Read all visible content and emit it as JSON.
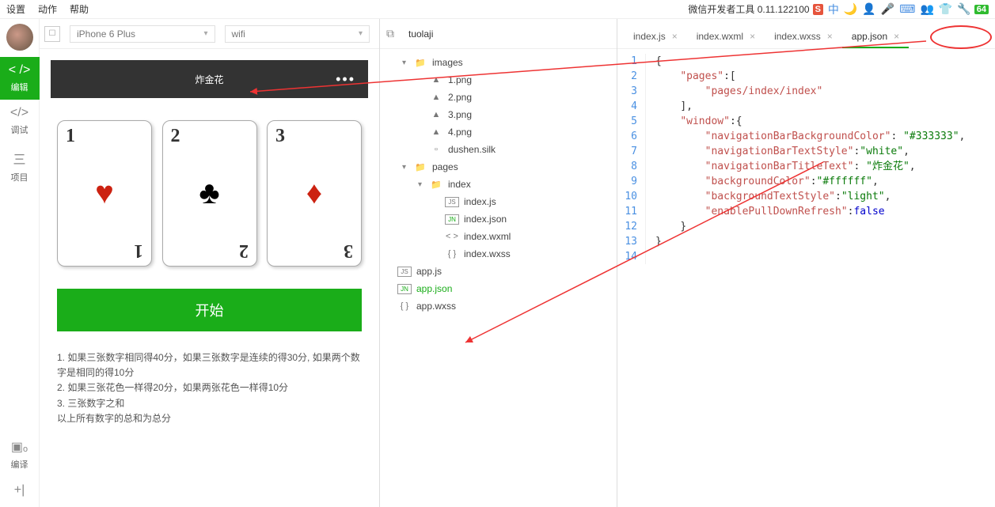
{
  "topbar": {
    "items": [
      "设置",
      "动作",
      "帮助"
    ],
    "version": "微信开发者工具 0.11.122100",
    "badge_s": "S",
    "badge_64": "64"
  },
  "iconcol": {
    "items": [
      {
        "icon": "< />",
        "label": "编辑"
      },
      {
        "icon": "</>",
        "label": "调试"
      },
      {
        "icon": "三",
        "label": "项目"
      }
    ],
    "bottom": [
      {
        "icon": "▣ₒ",
        "label": "编译"
      },
      {
        "icon": "+|",
        "label": ""
      }
    ]
  },
  "sim": {
    "device": "iPhone 6 Plus",
    "network": "wifi",
    "nav_title": "炸金花",
    "cards": [
      {
        "num": "1",
        "suit": "♥",
        "cls": "heart"
      },
      {
        "num": "2",
        "suit": "♣",
        "cls": "club"
      },
      {
        "num": "3",
        "suit": "♦",
        "cls": "diamond"
      }
    ],
    "start": "开始",
    "rules": [
      "1. 如果三张数字相同得40分，如果三张数字是连续的得30分, 如果两个数字是相同的得10分",
      "2. 如果三张花色一样得20分，如果两张花色一样得10分",
      "3. 三张数字之和",
      "以上所有数字的总和为总分"
    ]
  },
  "tree": {
    "project": "tuolaji",
    "nodes": [
      {
        "depth": 0,
        "icon": "folder",
        "arrow": "▾",
        "label": "images"
      },
      {
        "depth": 1,
        "icon": "img",
        "arrow": "",
        "label": "1.png"
      },
      {
        "depth": 1,
        "icon": "img",
        "arrow": "",
        "label": "2.png"
      },
      {
        "depth": 1,
        "icon": "img",
        "arrow": "",
        "label": "3.png"
      },
      {
        "depth": 1,
        "icon": "img",
        "arrow": "",
        "label": "4.png"
      },
      {
        "depth": 1,
        "icon": "file",
        "arrow": "",
        "label": "dushen.silk"
      },
      {
        "depth": 0,
        "icon": "folder",
        "arrow": "▾",
        "label": "pages"
      },
      {
        "depth": 1,
        "icon": "folder",
        "arrow": "▾",
        "label": "index"
      },
      {
        "depth": 2,
        "icon": "js",
        "arrow": "",
        "label": "index.js"
      },
      {
        "depth": 2,
        "icon": "jn",
        "arrow": "",
        "label": "index.json"
      },
      {
        "depth": 2,
        "icon": "wxml",
        "arrow": "",
        "label": "index.wxml"
      },
      {
        "depth": 2,
        "icon": "wxss",
        "arrow": "",
        "label": "index.wxss"
      },
      {
        "depth": -1,
        "icon": "js",
        "arrow": "",
        "label": "app.js"
      },
      {
        "depth": -1,
        "icon": "jn",
        "arrow": "",
        "label": "app.json",
        "sel": true
      },
      {
        "depth": -1,
        "icon": "wxss",
        "arrow": "",
        "label": "app.wxss"
      }
    ]
  },
  "editor": {
    "tabs": [
      {
        "label": "index.js"
      },
      {
        "label": "index.wxml"
      },
      {
        "label": "index.wxss"
      },
      {
        "label": "app.json",
        "active": true
      }
    ],
    "code": [
      [
        {
          "t": "{",
          "c": "c-punc"
        }
      ],
      [
        {
          "t": "    ",
          "c": ""
        },
        {
          "t": "\"pages\"",
          "c": "c-str"
        },
        {
          "t": ":[",
          "c": "c-punc"
        }
      ],
      [
        {
          "t": "        ",
          "c": ""
        },
        {
          "t": "\"pages/index/index\"",
          "c": "c-str"
        }
      ],
      [
        {
          "t": "    ",
          "c": ""
        },
        {
          "t": "],",
          "c": "c-punc"
        }
      ],
      [
        {
          "t": "    ",
          "c": ""
        },
        {
          "t": "\"window\"",
          "c": "c-str"
        },
        {
          "t": ":{",
          "c": "c-punc"
        }
      ],
      [
        {
          "t": "        ",
          "c": ""
        },
        {
          "t": "\"navigationBarBackgroundColor\"",
          "c": "c-str"
        },
        {
          "t": ": ",
          "c": "c-punc"
        },
        {
          "t": "\"#333333\"",
          "c": "c-val"
        },
        {
          "t": ",",
          "c": "c-punc"
        }
      ],
      [
        {
          "t": "        ",
          "c": ""
        },
        {
          "t": "\"navigationBarTextStyle\"",
          "c": "c-str"
        },
        {
          "t": ":",
          "c": "c-punc"
        },
        {
          "t": "\"white\"",
          "c": "c-val"
        },
        {
          "t": ",",
          "c": "c-punc"
        }
      ],
      [
        {
          "t": "        ",
          "c": ""
        },
        {
          "t": "\"navigationBarTitleText\"",
          "c": "c-str"
        },
        {
          "t": ": ",
          "c": "c-punc"
        },
        {
          "t": "\"炸金花\"",
          "c": "c-val"
        },
        {
          "t": ",",
          "c": "c-punc"
        }
      ],
      [
        {
          "t": "        ",
          "c": ""
        },
        {
          "t": "\"backgroundColor\"",
          "c": "c-str"
        },
        {
          "t": ":",
          "c": "c-punc"
        },
        {
          "t": "\"#ffffff\"",
          "c": "c-val"
        },
        {
          "t": ",",
          "c": "c-punc"
        }
      ],
      [
        {
          "t": "        ",
          "c": ""
        },
        {
          "t": "\"backgroundTextStyle\"",
          "c": "c-str"
        },
        {
          "t": ":",
          "c": "c-punc"
        },
        {
          "t": "\"light\"",
          "c": "c-val"
        },
        {
          "t": ",",
          "c": "c-punc"
        }
      ],
      [
        {
          "t": "        ",
          "c": ""
        },
        {
          "t": "\"enablePullDownRefresh\"",
          "c": "c-str"
        },
        {
          "t": ":",
          "c": "c-punc"
        },
        {
          "t": "false",
          "c": "c-false"
        }
      ],
      [
        {
          "t": "    ",
          "c": ""
        },
        {
          "t": "}",
          "c": "c-punc"
        }
      ],
      [
        {
          "t": "}",
          "c": "c-punc"
        }
      ],
      [
        {
          "t": "",
          "c": ""
        }
      ]
    ]
  }
}
